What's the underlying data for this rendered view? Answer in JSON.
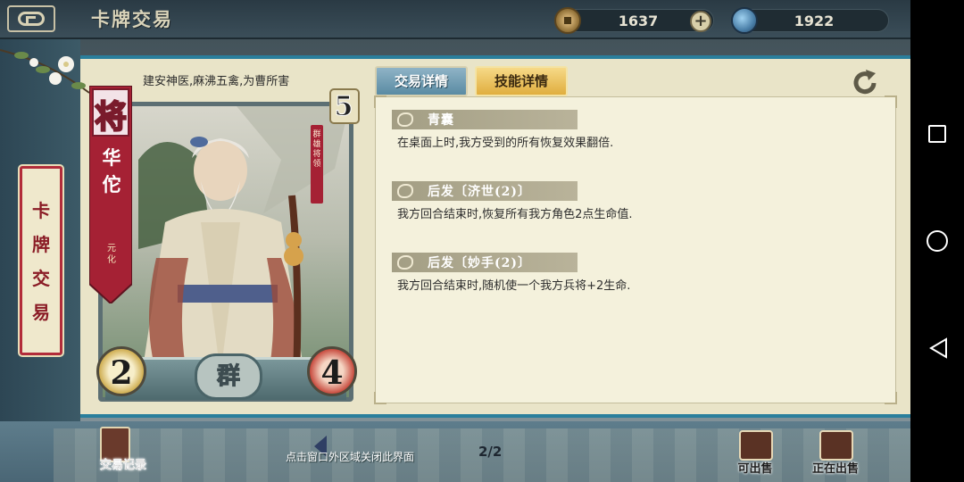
{
  "header": {
    "title": "卡牌交易",
    "coins": "1637",
    "gems": "1922",
    "add_label": "+"
  },
  "sidebar": {
    "tag": "卡牌交易"
  },
  "card": {
    "description": "建安神医,麻沸五禽,为曹所害",
    "type_char": "将",
    "name": "华佗",
    "subtitle": "元化",
    "side_label": "群雄将领",
    "cost": "5",
    "attack": "2",
    "health": "4",
    "faction": "群"
  },
  "tabs": [
    {
      "label": "交易详情",
      "active": false
    },
    {
      "label": "技能详情",
      "active": true
    }
  ],
  "skills": [
    {
      "name": "青囊",
      "description": "在桌面上时,我方受到的所有恢复效果翻倍."
    },
    {
      "name": "后发〔济世(2)〕",
      "description": "我方回合结束时,恢复所有我方角色2点生命值."
    },
    {
      "name": "后发〔妙手(2)〕",
      "description": "我方回合结束时,随机使一个我方兵将+2生命."
    }
  ],
  "footer": {
    "record_label": "交易记录",
    "close_hint": "点击窗口外区域关闭此界面",
    "page": "2/2",
    "sellable_label": "可出售",
    "selling_label": "正在出售"
  },
  "colors": {
    "accent_blue": "#2a7f9c",
    "tab_active": "#e0ae3f",
    "tab_inactive": "#5a8ba3",
    "card_red": "#a52134"
  },
  "icons": [
    "back-icon",
    "coin-icon",
    "gem-icon",
    "plus-icon",
    "refresh-icon",
    "seal-icon",
    "record-icon",
    "prev-arrow-icon",
    "sellable-icon",
    "selling-icon"
  ]
}
